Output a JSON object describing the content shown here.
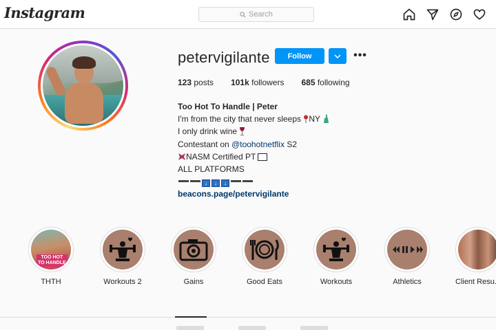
{
  "nav": {
    "logo": "Instagram",
    "search_placeholder": "Search",
    "icons": [
      "home-icon",
      "direct-icon",
      "explore-icon",
      "activity-icon"
    ]
  },
  "profile": {
    "username": "petervigilante",
    "follow_label": "Follow",
    "more_label": "•••",
    "stats": {
      "posts_count": "123",
      "posts_label": "posts",
      "followers_count": "101k",
      "followers_label": "followers",
      "following_count": "685",
      "following_label": "following"
    },
    "bio": {
      "name": "Too Hot To Handle | Peter",
      "line1": "I'm from the city that never sleeps",
      "line1_suffix": "NY",
      "line2": "I only drink wine",
      "line3_prefix": "Contestant on",
      "line3_mention": "@toohotnetflix",
      "line3_suffix": "S2",
      "line4": "NASM Certified PT",
      "line5": "ALL PLATFORMS",
      "link": "beacons.page/petervigilante"
    }
  },
  "highlights": [
    {
      "label": "THTH",
      "icon": "photo"
    },
    {
      "label": "Workouts 2",
      "icon": "weightlifter-icon"
    },
    {
      "label": "Gains",
      "icon": "camera-icon"
    },
    {
      "label": "Good Eats",
      "icon": "plate-cutlery-icon"
    },
    {
      "label": "Workouts",
      "icon": "weightlifter-icon"
    },
    {
      "label": "Athletics",
      "icon": "media-controls-icon"
    },
    {
      "label": "Client Resu...",
      "icon": "photo"
    }
  ],
  "colors": {
    "accent": "#0095f6",
    "link": "#00376b",
    "highlight_bg": "#a97f6e"
  }
}
